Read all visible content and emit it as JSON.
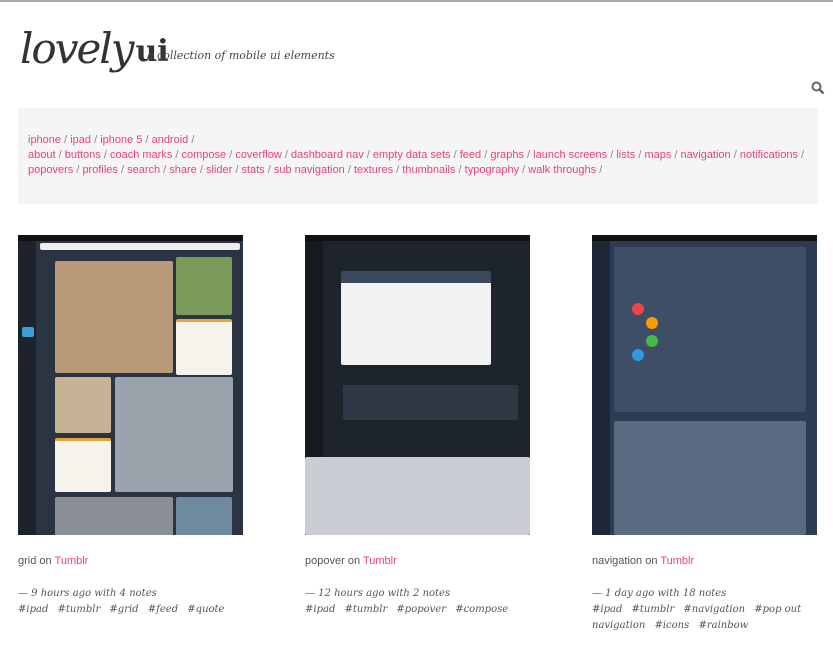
{
  "header": {
    "logo_script": "lovely",
    "logo_bold": "ui",
    "tagline": "a collection of mobile ui elements",
    "search_icon": "search-icon"
  },
  "categories": {
    "row1": [
      "iphone",
      "ipad",
      "iphone 5",
      "android"
    ],
    "row2": [
      "about",
      "buttons",
      "coach marks",
      "compose",
      "coverflow",
      "dashboard nav",
      "empty data sets",
      "feed",
      "graphs",
      "launch screens",
      "lists",
      "maps",
      "navigation",
      "notifications",
      "popovers",
      "profiles",
      "search",
      "share",
      "slider",
      "stats",
      "sub navigation",
      "textures",
      "thumbnails",
      "typography",
      "walk throughs"
    ]
  },
  "link_color": "#ec3f7a",
  "posts": [
    {
      "title": "grid",
      "on": "on",
      "source": "Tumblr",
      "meta": "— 9 hours ago with 4 notes",
      "tags": [
        "#ipad",
        "#tumblr",
        "#grid",
        "#feed",
        "#quote"
      ]
    },
    {
      "title": "popover",
      "on": "on",
      "source": "Tumblr",
      "meta": "— 12 hours ago with 2 notes",
      "tags": [
        "#ipad",
        "#tumblr",
        "#popover",
        "#compose"
      ]
    },
    {
      "title": "navigation",
      "on": "on",
      "source": "Tumblr",
      "meta": "— 1 day ago with 18 notes",
      "tags": [
        "#ipad",
        "#tumblr",
        "#navigation",
        "#pop out navigation",
        "#icons",
        "#rainbow"
      ]
    }
  ]
}
